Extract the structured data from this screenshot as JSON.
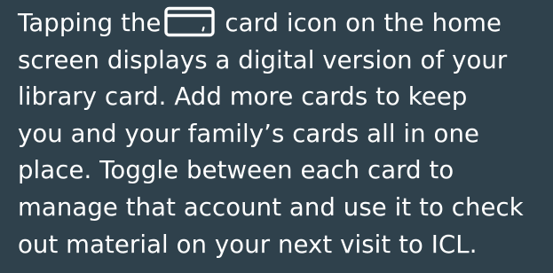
{
  "description_panel": {
    "line_1_before_icon": "Tapping the",
    "line_1_after_icon": " card icon on the home",
    "line_2": "screen displays a digital version of your",
    "line_3": "library card.  Add more cards to keep",
    "line_4": "you and your family’s cards all in one",
    "line_5": "place.  Toggle between each card to",
    "line_6": "manage that account and use it to check",
    "line_7": "out material on your next visit to ICL.",
    "icon": "library-card-icon",
    "colors": {
      "background": "#2f414c",
      "text": "#ffffff"
    }
  }
}
